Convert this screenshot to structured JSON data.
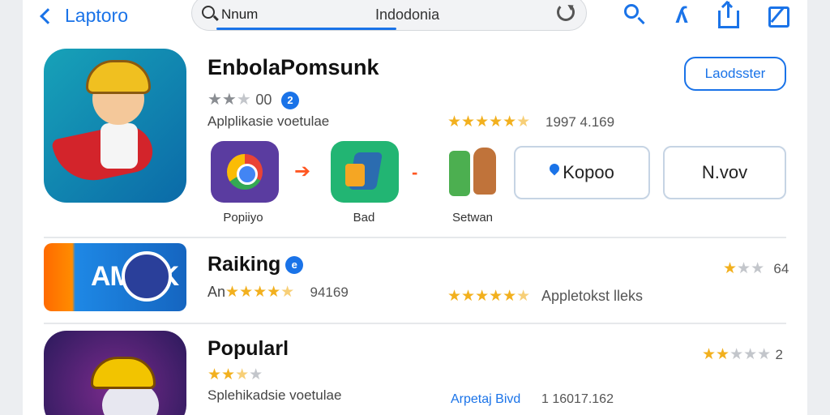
{
  "topbar": {
    "back_label": "Laptoro",
    "search_value": "Nnum",
    "search_region": "Indodonia"
  },
  "featured": {
    "title": "EnbolaPomsunk",
    "rating_value": "00",
    "badge": "2",
    "subtitle": "Aplplikasie voetulae",
    "store_rating": "1997 4.169",
    "get_button": "Laodsster",
    "related": [
      {
        "label": "Popiiyo"
      },
      {
        "label": "Bad"
      },
      {
        "label": "Setwan"
      }
    ],
    "outline_buttons": [
      "Kopoo",
      "N.vov"
    ]
  },
  "ranking": {
    "title": "Raiking",
    "badge": "e",
    "sub_prefix": "An",
    "count": "94169",
    "right_rating": "64",
    "right_label": "Appletokst lleks"
  },
  "popular": {
    "title": "Popularl",
    "right_rating": "2",
    "subtitle": "Splehikadsie voetulae",
    "link": "Arpetaj Bivd",
    "number": "1 16017.162"
  },
  "colors": {
    "accent": "#1a73e8",
    "star": "#f2b01e",
    "star_off": "#c3c6cb"
  }
}
